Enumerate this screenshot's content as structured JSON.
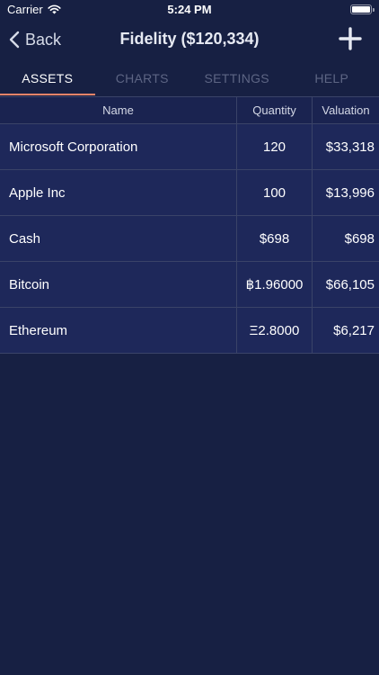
{
  "status_bar": {
    "carrier": "Carrier",
    "time": "5:24 PM",
    "icons": [
      "wifi-icon",
      "battery-icon"
    ]
  },
  "nav": {
    "back_label": "Back",
    "title": "Fidelity ($120,334)",
    "back_icon": "chevron-left-icon",
    "add_icon": "plus-icon"
  },
  "tabs": [
    {
      "label": "ASSETS",
      "active": true
    },
    {
      "label": "CHARTS",
      "active": false
    },
    {
      "label": "SETTINGS",
      "active": false
    },
    {
      "label": "HELP",
      "active": false
    }
  ],
  "colors": {
    "background": "#172043",
    "row_background": "#1e285a",
    "tab_underline": "#e88468",
    "tab_inactive": "#5d6584"
  },
  "table": {
    "headers": {
      "name": "Name",
      "quantity": "Quantity",
      "valuation": "Valuation"
    },
    "rows": [
      {
        "name": "Microsoft Corporation",
        "quantity": "120",
        "valuation": "$33,318"
      },
      {
        "name": "Apple Inc",
        "quantity": "100",
        "valuation": "$13,996"
      },
      {
        "name": "Cash",
        "quantity": "$698",
        "valuation": "$698"
      },
      {
        "name": "Bitcoin",
        "quantity": "฿1.96000",
        "valuation": "$66,105"
      },
      {
        "name": "Ethereum",
        "quantity": "Ξ2.8000",
        "valuation": "$6,217"
      }
    ]
  }
}
